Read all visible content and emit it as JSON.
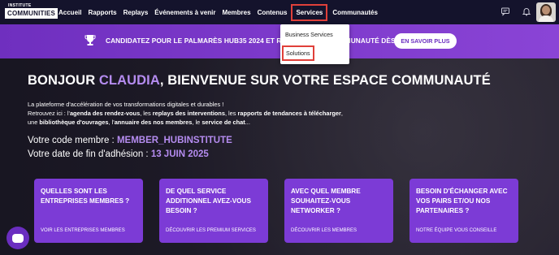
{
  "logo": {
    "top": "INSTITUTE",
    "main": "COMMUNITIES"
  },
  "nav": {
    "items": [
      "Accueil",
      "Rapports",
      "Replays",
      "Événements à venir",
      "Membres",
      "Contenus",
      "Services",
      "Communautés"
    ],
    "active_index": 6
  },
  "banner": {
    "text": "CANDIDATEZ POUR LE PALMARÈS HUB35 2024 ET REJOIGNEZ LA COMMUNAUTÉ DÈS DEMAIN !",
    "button": "EN SAVOIR PLUS"
  },
  "dropdown": {
    "items": [
      "Business Services",
      "Solutions"
    ],
    "highlighted_index": 1
  },
  "hero": {
    "title_prefix": "BONJOUR ",
    "title_name": "CLAUDIA",
    "title_suffix": ", BIENVENUE SUR VOTRE ESPACE COMMUNAUTÉ",
    "desc_line1": "La plateforme d'accélération de vos transformations digitales et durables !",
    "desc_line2_pre": "Retrouvez ici : l'",
    "desc_agenda": "agenda des rendez-vous",
    "desc_sep1": ", les ",
    "desc_replays": "replays des interventions",
    "desc_sep2": ", les ",
    "desc_rapports": "rapports de tendances à télécharger",
    "desc_sep3": ",",
    "desc_line3_pre": "une ",
    "desc_biblio": "bibliothèque d'ouvrages",
    "desc_sep4": ", l'",
    "desc_annuaire": "annuaire des nos membres",
    "desc_sep5": ", le ",
    "desc_chat": "service de chat",
    "desc_end": "...",
    "code_label": "Votre code membre : ",
    "code_value": "MEMBER_HUBINSTITUTE",
    "date_label": "Votre date de fin d'adhésion : ",
    "date_value": "13 JUIN 2025"
  },
  "cards": [
    {
      "question": "QUELLES SONT LES ENTREPRISES MEMBRES ?",
      "link": "VOIR LES ENTREPRISES MEMBRES"
    },
    {
      "question": "DE QUEL SERVICE ADDITIONNEL AVEZ-VOUS BESOIN ?",
      "link": "DÉCOUVRIR LES PREMIUM SERVICES"
    },
    {
      "question": "AVEC QUEL MEMBRE SOUHAITEZ-VOUS NETWORKER ?",
      "link": "DÉCOUVRIR LES MEMBRES"
    },
    {
      "question": "BESOIN D'ÉCHANGER AVEC VOS PAIRS ET/OU NOS PARTENAIRES ?",
      "link": "NOTRE ÉQUIPE VOUS CONSEILLE"
    }
  ],
  "icons": {
    "chat_top": "chat-icon",
    "bell": "bell-icon",
    "trophy": "trophy-icon",
    "chat_bubble": "chat-bubble-icon"
  },
  "colors": {
    "nav_bg": "#14132c",
    "accent_purple": "#7c3bd6",
    "highlight_red": "#e0403a",
    "name_purple": "#b58cf0"
  }
}
